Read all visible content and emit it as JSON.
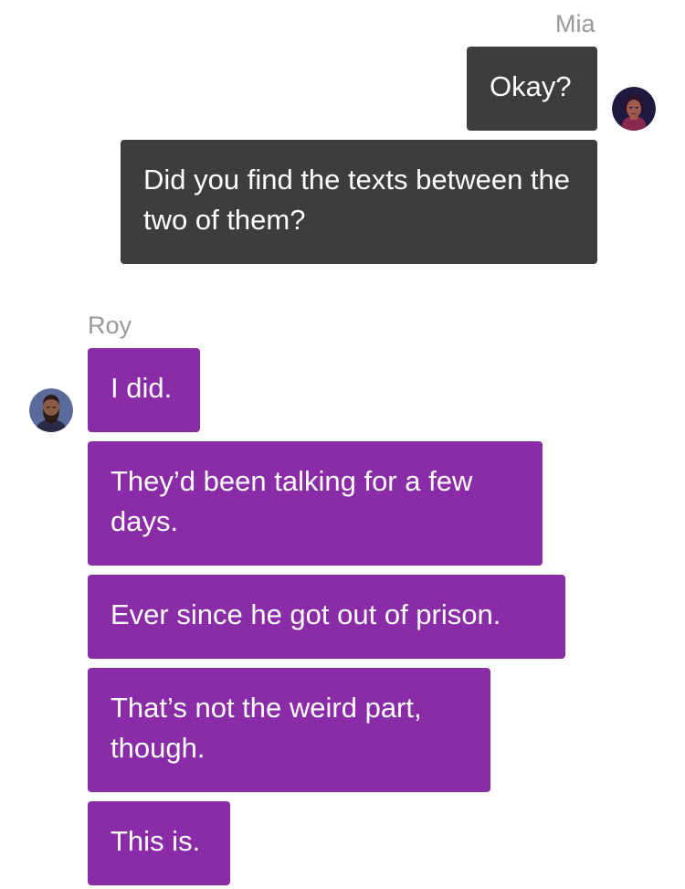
{
  "thread": {
    "mia": {
      "name": "Mia",
      "bubble_color": "#3d3d3d",
      "avatar_icon": "woman-avatar",
      "messages": [
        "Okay?",
        "Did you find the texts between the two of them?"
      ]
    },
    "roy": {
      "name": "Roy",
      "bubble_color": "#8a2ba8",
      "avatar_icon": "bearded-man-avatar",
      "messages": [
        "I did.",
        "They’d been talking for a few days.",
        "Ever since he got out of prison.",
        "That’s not the weird part, though.",
        "This is."
      ]
    }
  }
}
